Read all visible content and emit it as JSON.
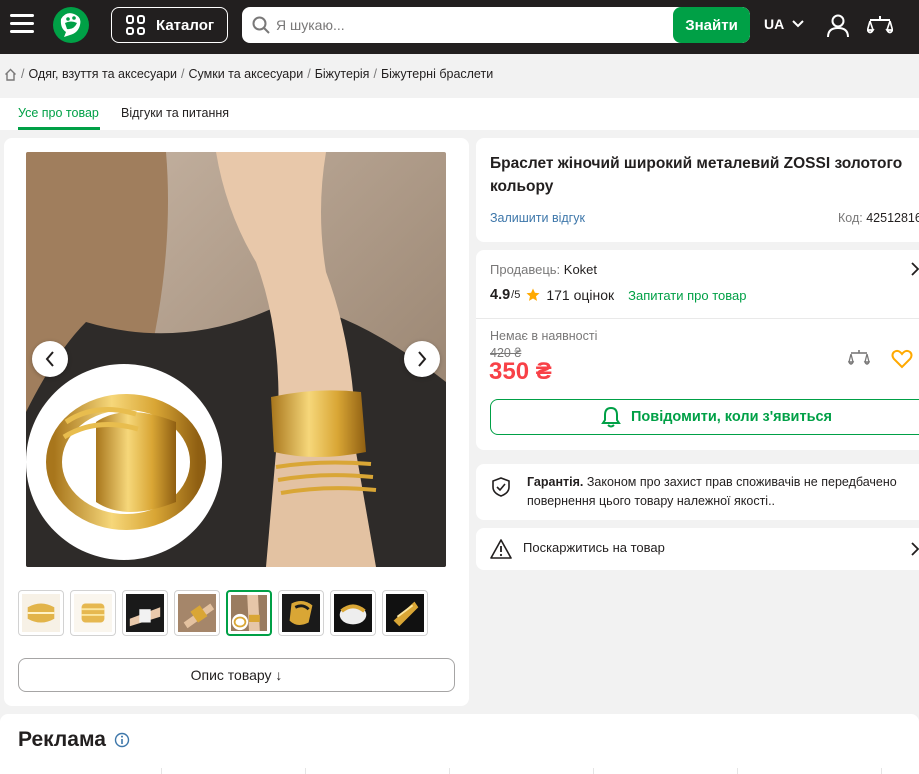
{
  "header": {
    "catalog_label": "Каталог",
    "search_placeholder": "Я шукаю...",
    "search_button": "Знайти",
    "language": "UA",
    "icons": [
      "menu-icon",
      "logo-icon",
      "catalog-grid-icon",
      "search-icon",
      "chevron-down-icon",
      "user-icon",
      "compare-icon"
    ],
    "brand_color": "#00a046"
  },
  "breadcrumbs": [
    "Одяг, взуття та аксесуари",
    "Сумки та аксесуари",
    "Біжутерія",
    "Біжутерні браслети"
  ],
  "tabs": [
    {
      "label": "Усе про товар",
      "active": true
    },
    {
      "label": "Відгуки та питання",
      "active": false
    }
  ],
  "gallery": {
    "thumbnail_count": 8,
    "active_thumbnail": 5,
    "description_button": "Опис товару ↓"
  },
  "product": {
    "title": "Браслет жіночий широкий металевий ZOSSI золотого кольору",
    "leave_review": "Залишити відгук",
    "code_label": "Код:",
    "code_value": "42512816"
  },
  "seller": {
    "label": "Продавець:",
    "name": "Koket"
  },
  "rating": {
    "value": "4.9",
    "scale": "/5",
    "count_text": "171 оцінок",
    "ask_link": "Запитати про товар"
  },
  "pricing": {
    "status": "Немає в наявності",
    "old_price": "420 ₴",
    "price": "350 ₴",
    "price_color": "#f84147",
    "notify_button": "Повідомити, коли з'явиться"
  },
  "warranty": {
    "title": "Гарантія.",
    "text": "Законом про захист прав споживачів не передбачено повернення цього товару належної якості.."
  },
  "report": {
    "label": "Поскаржитись на товар"
  },
  "ads": {
    "title": "Реклама"
  }
}
